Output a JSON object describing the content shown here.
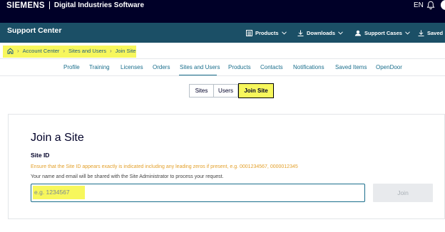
{
  "topbar": {
    "brand": "SIEMENS",
    "product": "Digital Industries Software",
    "language": "EN",
    "icons": [
      "bell-icon",
      "avatar"
    ]
  },
  "support": {
    "title": "Support Center",
    "menu": [
      {
        "label": "Products",
        "icon": "products-icon"
      },
      {
        "label": "Downloads",
        "icon": "download-icon"
      },
      {
        "label": "Support Cases",
        "icon": "support-icon"
      },
      {
        "label": "Saved",
        "icon": "saved-icon"
      }
    ]
  },
  "breadcrumb": [
    "Account Center",
    "Sites and Users",
    "Join Site"
  ],
  "nav": {
    "items": [
      "Profile",
      "Training",
      "Licenses",
      "Orders",
      "Sites and Users",
      "Products",
      "Contacts",
      "Notifications",
      "Saved Items",
      "OpenDoor"
    ],
    "active": "Sites and Users"
  },
  "segment": {
    "buttons": [
      "Sites",
      "Users",
      "Join Site"
    ],
    "active": "Join Site"
  },
  "form": {
    "title": "Join a Site",
    "label": "Site ID",
    "hint": "Ensure that the Site ID appears exactly is indicated including any leading zeros if present, e.g. 0001234567, 0000012345",
    "share_note": "Your name and email will be shared with the Site Administrator to process your request.",
    "placeholder": "e.g. 1234567",
    "value": "",
    "button": "Join"
  },
  "colors": {
    "topbar": "#000028",
    "supportbar": "#1b4f66",
    "link": "#1a6e8c",
    "highlight": "#f7f75c",
    "hint": "#e3a02b"
  }
}
